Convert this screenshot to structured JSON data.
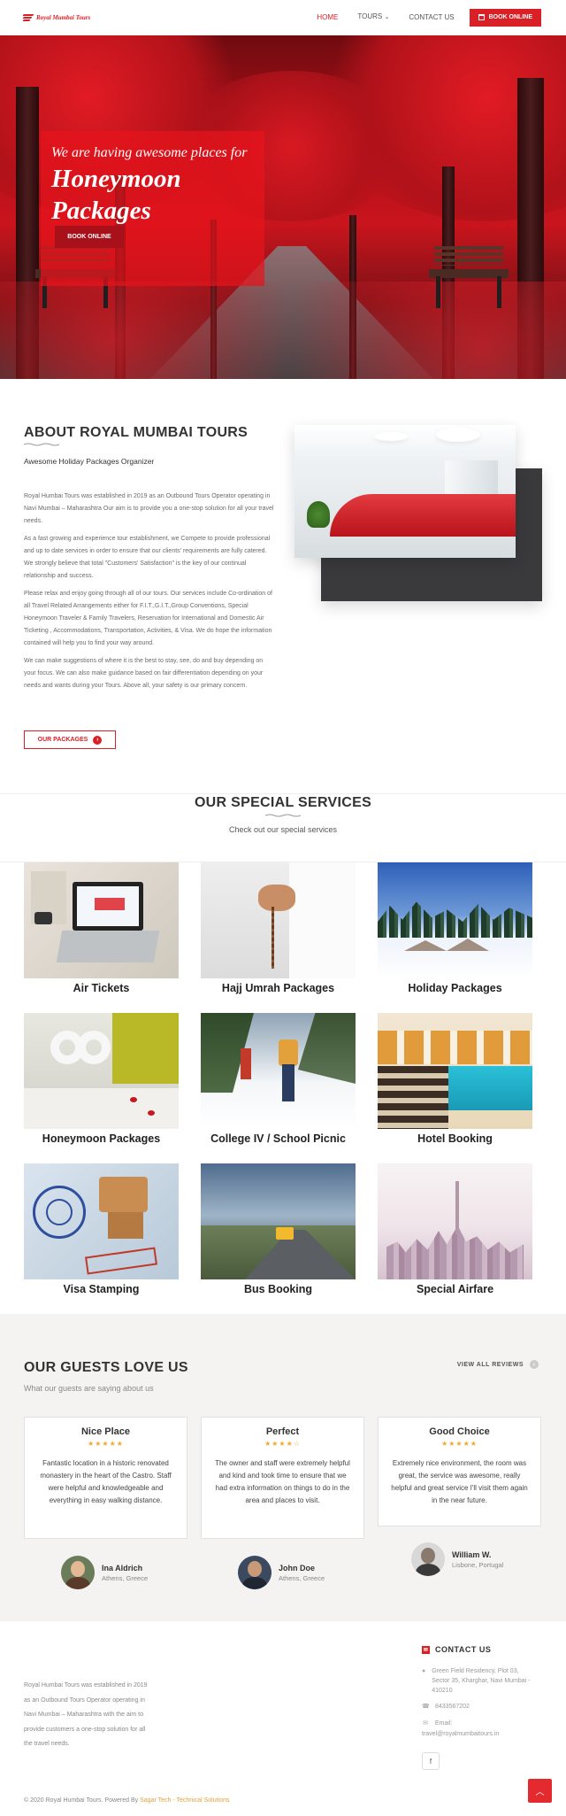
{
  "nav": {
    "logo_text": "Royal Mumbai Tours",
    "links": [
      "HOME",
      "TOURS",
      "CONTACT US"
    ],
    "tours_chevron": "⌄",
    "book_label": "BOOK ONLINE",
    "book_icon": "calendar-icon"
  },
  "hero": {
    "subtitle": "We are having awesome places for",
    "title_line1": "Honeymoon",
    "title_line2": "Packages",
    "button": "BOOK ONLINE"
  },
  "about": {
    "title": "ABOUT ROYAL MUMBAI TOURS",
    "subtitle": "Awesome Holiday Packages Organizer",
    "paragraphs": [
      "Royal Humbai Tours was established in 2019 as an Outbound Tours Operator operating in Navi Mumbai – Maharashtra Our aim is to provide you a one-stop solution for all your travel needs.",
      "As a fast growing and experience tour establishment, we Compete to provide professional and up to date services in order to ensure that our clients' requirements are fully catered. We strongly believe that total \"Customers' Satisfaction\" is the key of our continual relationship and success.",
      "Please relax and enjoy going through all of our tours. Our services include Co-ordination of all Travel Related Arrangements either for F.I.T.,G.I.T.,Group Conventions, Special Honeymoon Traveler & Family Travelers, Reservation for International and Domestic Air Ticketing , Accommodations, Transportation, Activities, & Visa. We do hope the information contained will help you to find your way around.",
      "We can make suggestions of where it is the best to stay, see, do and buy depending on your focus. We can also make guidance based on fair differentiation depending on your needs and wants during your Tours. Above all, your safety is our primary concern."
    ],
    "button": "OUR PACKAGES",
    "button_icon": "arrow-right-circle-icon"
  },
  "services": {
    "title": "OUR SPECIAL SERVICES",
    "subtitle": "Check out our special services",
    "items": [
      "Air Tickets",
      "Hajj Umrah Packages",
      "Holiday Packages",
      "Honeymoon Packages",
      "College IV / School Picnic",
      "Hotel Booking",
      "Visa Stamping",
      "Bus Booking",
      "Special Airfare"
    ]
  },
  "testimonials": {
    "title": "OUR GUESTS LOVE US",
    "subtitle": "What our guests are saying about us",
    "view_all": "VIEW ALL REVIEWS",
    "reviews": [
      {
        "title": "Nice Place",
        "rating": 5,
        "stars": "★★★★★",
        "text": "Fantastic location in a historic renovated monastery in the heart of the Castro. Staff were helpful and knowledgeable and everything in easy walking distance.",
        "name": "Ina Aldrich",
        "location": "Athens, Greece"
      },
      {
        "title": "Perfect",
        "rating": 4,
        "stars": "★★★★☆",
        "text": "The owner and staff were extremely helpful and kind and took time to ensure that we had extra information on things to do in the area and places to visit.",
        "name": "John Doe",
        "location": "Athens, Greece"
      },
      {
        "title": "Good Choice",
        "rating": 5,
        "stars": "★★★★★",
        "text": "Extremely nice environment, the room was great, the service was awesome, really helpful and great service I'll visit them again in the near future.",
        "name": "William W.",
        "location": "Lisbone, Portugal"
      }
    ]
  },
  "footer": {
    "about": "Royal Humbai Tours was established in 2019 as an Outbound Tours Operator operating in Navi Mumbai – Maharashtra with the aim to provide customers a one-stop solution for all the travel needs.",
    "contact_title": "CONTACT US",
    "address": "Green Field Residency, Plot 03, Sector 35, Kharghar, Navi Mumbai - 410210",
    "phone": "8433567202",
    "email_label": "Email:",
    "email": "travel@royalmumbaitours.in",
    "social": "f",
    "copyright_prefix": "© 2020 Royal Humbai Tours. Powered By ",
    "copyright_link": "Sagar Tech - Technical Solutions"
  },
  "colors": {
    "accent": "#d92027",
    "star": "#f0a830",
    "band": "#f4f3f1"
  }
}
